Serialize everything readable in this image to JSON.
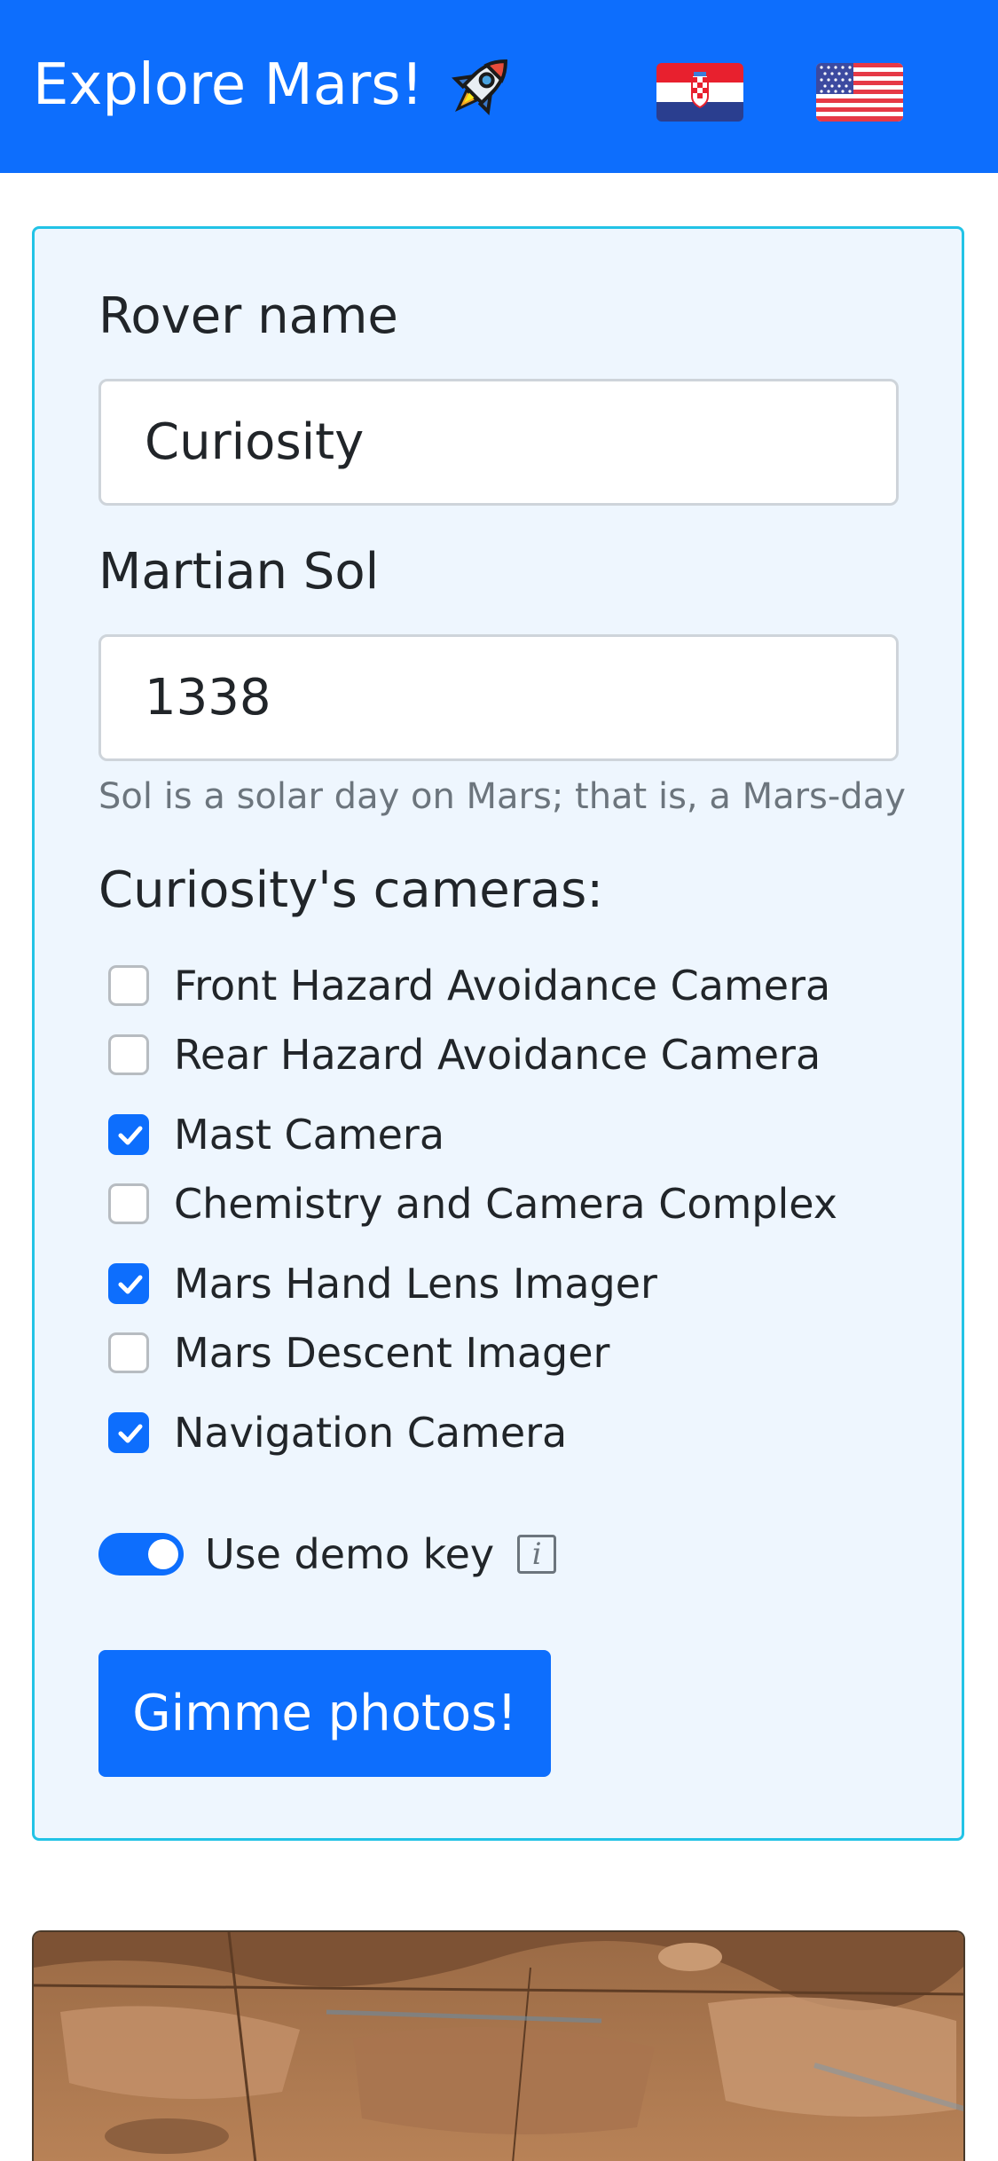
{
  "navbar": {
    "brand_text": "Explore Mars!",
    "brand_icon": "rocket-icon",
    "languages": [
      {
        "name": "Croatian",
        "icon": "croatia-flag-icon"
      },
      {
        "name": "English",
        "icon": "usa-flag-icon"
      }
    ]
  },
  "form": {
    "rover_label": "Rover name",
    "rover_value": "Curiosity",
    "sol_label": "Martian Sol",
    "sol_value": "1338",
    "sol_help": "Sol is a solar day on Mars; that is, a Mars-day",
    "cameras_title": "Curiosity's cameras:",
    "cameras": [
      {
        "label": "Front Hazard Avoidance Camera",
        "checked": false
      },
      {
        "label": "Rear Hazard Avoidance Camera",
        "checked": false
      },
      {
        "label": "Mast Camera",
        "checked": true
      },
      {
        "label": "Chemistry and Camera Complex",
        "checked": false
      },
      {
        "label": "Mars Hand Lens Imager",
        "checked": true
      },
      {
        "label": "Mars Descent Imager",
        "checked": false
      },
      {
        "label": "Navigation Camera",
        "checked": true
      }
    ],
    "demo_key_label": "Use demo key",
    "demo_key_enabled": true,
    "info_glyph": "i",
    "submit_label": "Gimme photos!"
  },
  "colors": {
    "primary": "#0d6efd",
    "card_bg": "#eef6fe",
    "card_border": "#22c3e6",
    "muted_text": "#6c757d"
  }
}
